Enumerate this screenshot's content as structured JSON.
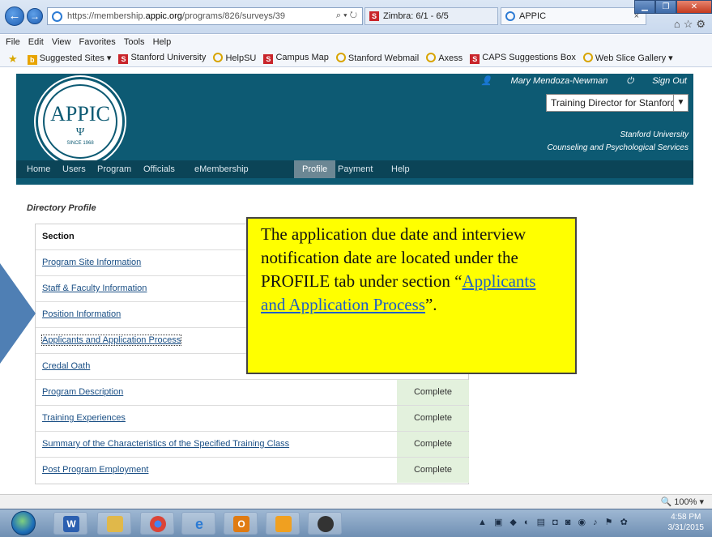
{
  "browser": {
    "url_prefix": "https://membership.",
    "url_domain": "appic.org",
    "url_path": "/programs/826/surveys/39",
    "addr_actions": "⌕ ▾ ↻",
    "tabs": [
      {
        "label": "Zimbra: 6/1 - 6/5"
      },
      {
        "label": "APPIC"
      }
    ],
    "menu": [
      "File",
      "Edit",
      "View",
      "Favorites",
      "Tools",
      "Help"
    ],
    "favorites": [
      "Suggested Sites ▾",
      "Stanford University",
      "HelpSU",
      "Campus Map",
      "Stanford Webmail",
      "Axess",
      "CAPS Suggestions Box",
      "Web Slice Gallery ▾"
    ],
    "zoom": "100%"
  },
  "site": {
    "logo_word": "APPIC",
    "logo_psi": "Ψ",
    "logo_since": "SINCE 1968",
    "user": "Mary Mendoza-Newman",
    "signout": "Sign Out",
    "role": "Training Director for Stanford Un",
    "institution_line1": "Stanford University",
    "institution_line2": "Counseling and Psychological Services",
    "nav": [
      "Home",
      "Users",
      "Program",
      "Officials",
      "eMembership",
      "Profile",
      "Payment",
      "Help"
    ],
    "active_nav": "Profile"
  },
  "directory": {
    "title": "Directory Profile",
    "header": "Section",
    "rows": [
      {
        "section": "Program Site Information",
        "status": ""
      },
      {
        "section": "Staff & Faculty Information",
        "status": ""
      },
      {
        "section": "Position Information",
        "status": ""
      },
      {
        "section": "Applicants and Application Process",
        "status": ""
      },
      {
        "section": "Credal Oath",
        "status": ""
      },
      {
        "section": "Program Description",
        "status": "Complete"
      },
      {
        "section": "Training Experiences",
        "status": "Complete"
      },
      {
        "section": "Summary of the Characteristics of the Specified Training Class",
        "status": "Complete"
      },
      {
        "section": "Post Program Employment",
        "status": "Complete"
      }
    ]
  },
  "callout": {
    "text": "The application due date and interview notification date are located under the PROFILE tab under section “",
    "link": "Applicants and Application Process",
    "suffix": "”."
  },
  "taskbar": {
    "time": "4:58 PM",
    "date": "3/31/2015"
  },
  "colors": {
    "header_bg": "#0d5a73",
    "nav_bg": "#0b4457",
    "complete_bg": "#e3f1dd",
    "callout_bg": "#ffff00"
  }
}
